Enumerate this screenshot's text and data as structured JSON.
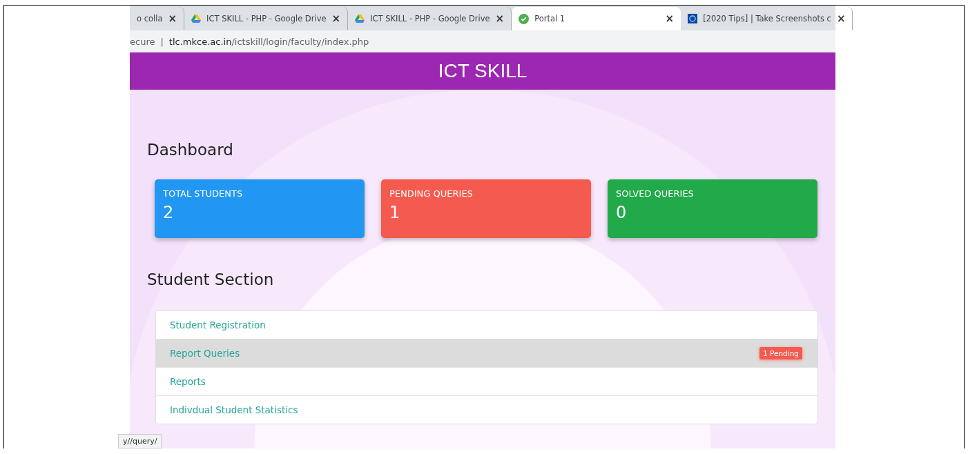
{
  "browser": {
    "tabs": [
      {
        "title": "o colla",
        "kind": "plain",
        "selected": false
      },
      {
        "title": "ICT SKILL - PHP - Google Drive",
        "kind": "drive",
        "selected": false
      },
      {
        "title": "ICT SKILL - PHP - Google Drive",
        "kind": "drive",
        "selected": false
      },
      {
        "title": "Portal 1",
        "kind": "check",
        "selected": true
      },
      {
        "title": "[2020 Tips] | Take Screenshots c",
        "kind": "site",
        "selected": false
      }
    ],
    "close_glyph": "×",
    "address": {
      "security": "ecure",
      "separator": "|",
      "host": "tlc.mkce.ac.in",
      "path": "/ictskill/login/faculty/index.php"
    },
    "status_url": "y//query/"
  },
  "header": {
    "title": "ICT SKILL"
  },
  "dashboard": {
    "title": "Dashboard",
    "cards": [
      {
        "label": "TOTAL STUDENTS",
        "value": "2",
        "color": "#2196f3"
      },
      {
        "label": "PENDING QUERIES",
        "value": "1",
        "color": "#f55a4e"
      },
      {
        "label": "SOLVED QUERIES",
        "value": "0",
        "color": "#21a94a"
      }
    ]
  },
  "student_section": {
    "title": "Student Section",
    "items": [
      {
        "label": "Student Registration",
        "selected": false
      },
      {
        "label": "Report Queries",
        "selected": true,
        "badge": "1 Pending"
      },
      {
        "label": "Reports",
        "selected": false
      },
      {
        "label": "Indivdual Student Statistics",
        "selected": false
      }
    ]
  }
}
